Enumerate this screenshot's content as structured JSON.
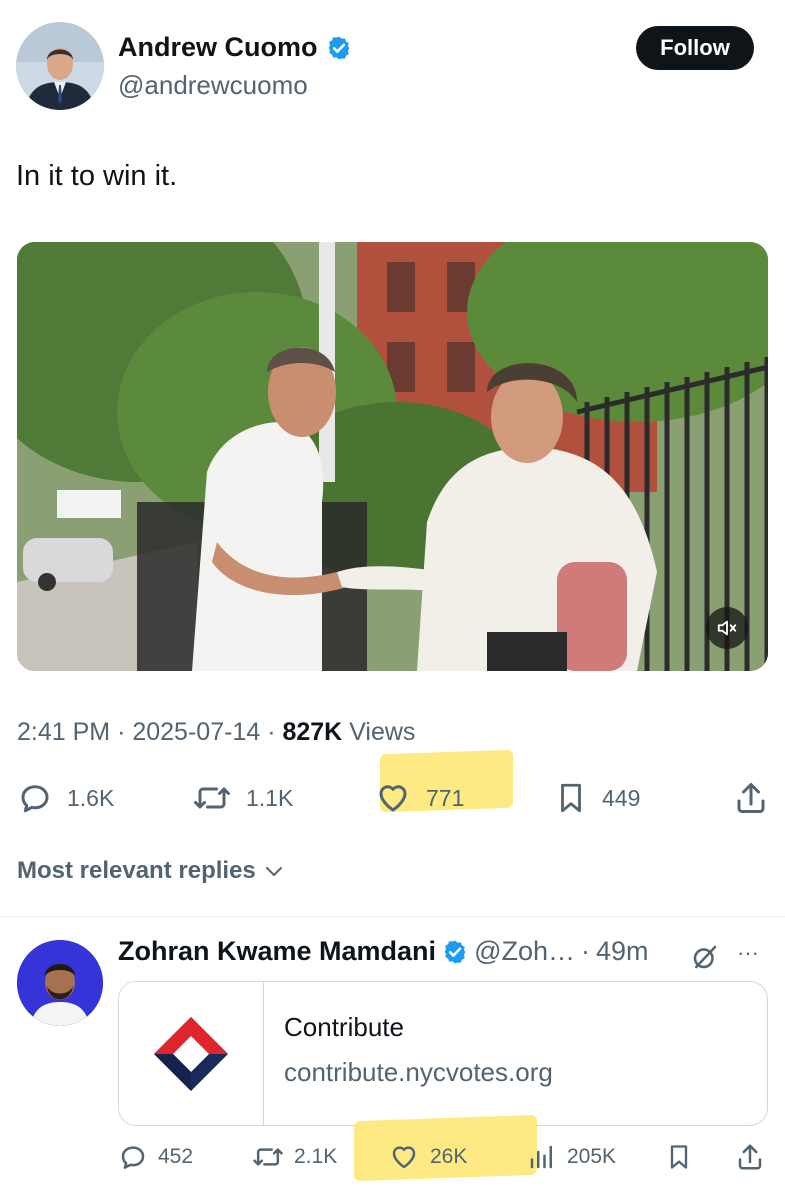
{
  "tweet": {
    "author_name": "Andrew Cuomo",
    "author_handle": "@andrewcuomo",
    "follow_label": "Follow",
    "text": "In it to win it.",
    "time": "2:41 PM",
    "date": "2025-07-14",
    "views_count": "827K",
    "views_label": "Views",
    "sep": "·",
    "actions": {
      "replies": "1.6K",
      "retweets": "1.1K",
      "likes": "771",
      "bookmarks": "449"
    }
  },
  "replies_filter": "Most relevant replies",
  "reply": {
    "author_name": "Zohran Kwame Mamdani",
    "author_handle": "@Zoh…",
    "time": "49m",
    "more": "···",
    "card": {
      "title": "Contribute",
      "url": "contribute.nycvotes.org"
    },
    "actions": {
      "replies": "452",
      "retweets": "2.1K",
      "likes": "26K",
      "views": "205K"
    }
  },
  "colors": {
    "verified": "#1d9bf0",
    "highlight": "#fde875",
    "secondary_text": "#536471"
  }
}
